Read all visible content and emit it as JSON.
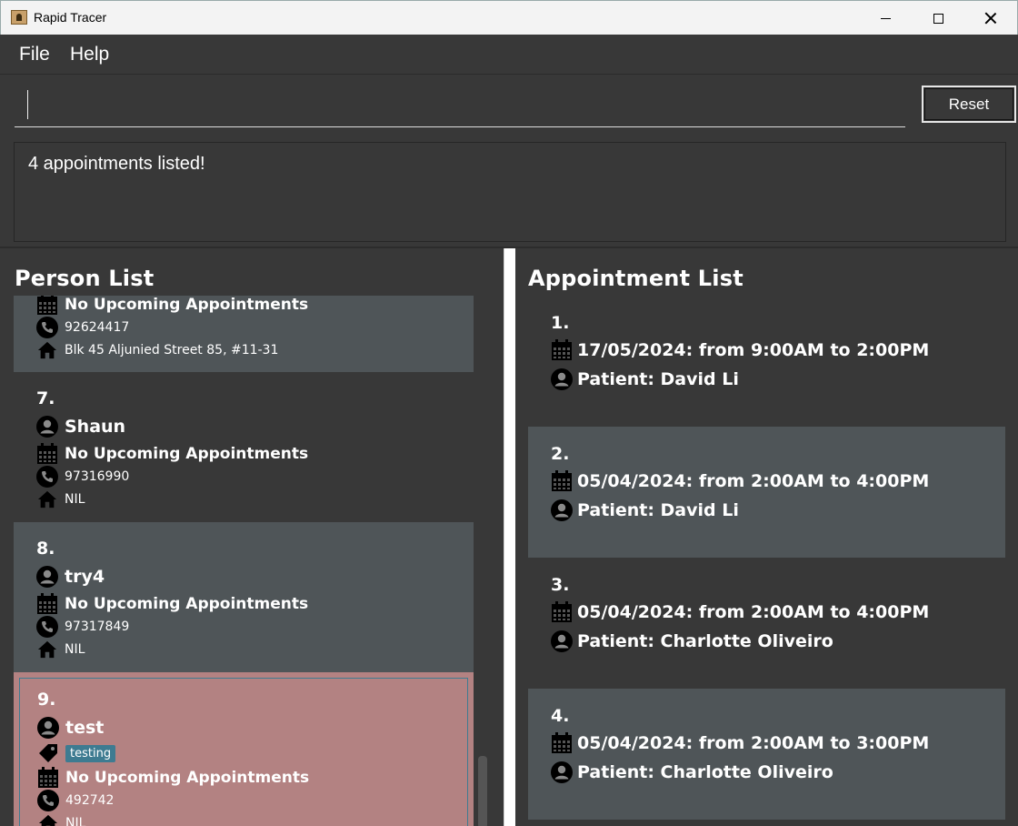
{
  "window": {
    "title": "Rapid Tracer"
  },
  "menu": {
    "file": "File",
    "help": "Help"
  },
  "command": {
    "value": "",
    "reset_label": "Reset"
  },
  "result": {
    "message": "4 appointments listed!"
  },
  "person_panel": {
    "title": "Person List",
    "partial_card": {
      "appointments": "No Upcoming Appointments",
      "phone": "92624417",
      "address": "Blk 45 Aljunied Street 85, #11-31"
    },
    "cards": [
      {
        "index": "7.",
        "name": "Shaun",
        "appointments": "No Upcoming Appointments",
        "phone": "97316990",
        "address": "NIL"
      },
      {
        "index": "8.",
        "name": "try4",
        "appointments": "No Upcoming Appointments",
        "phone": "97317849",
        "address": "NIL"
      },
      {
        "index": "9.",
        "name": "test",
        "tag": "testing",
        "appointments": "No Upcoming Appointments",
        "phone": "492742",
        "address": "NIL"
      }
    ]
  },
  "appointment_panel": {
    "title": "Appointment List",
    "items": [
      {
        "index": "1.",
        "time": "17/05/2024: from 9:00AM to 2:00PM",
        "patient": "Patient: David Li"
      },
      {
        "index": "2.",
        "time": "05/04/2024: from 2:00AM to 4:00PM",
        "patient": "Patient: David Li"
      },
      {
        "index": "3.",
        "time": "05/04/2024: from 2:00AM to 4:00PM",
        "patient": "Patient: Charlotte Oliveiro"
      },
      {
        "index": "4.",
        "time": "05/04/2024: from 2:00AM to 3:00PM",
        "patient": "Patient: Charlotte Oliveiro"
      }
    ]
  },
  "colors": {
    "background": "#383838",
    "card_alt": "#4f5558",
    "selected_card": "#b38282",
    "tag": "#3e7b91"
  }
}
